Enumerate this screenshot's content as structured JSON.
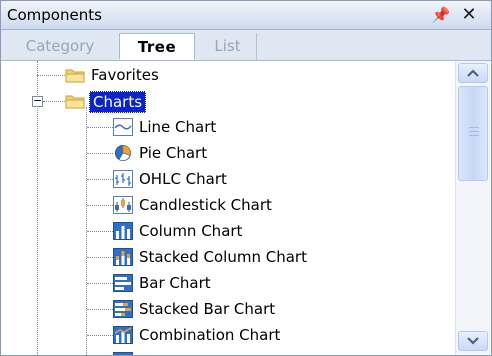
{
  "panel": {
    "title": "Components",
    "pin_icon": "pushpin-icon",
    "close_icon": "close-icon"
  },
  "tabs": [
    {
      "label": "Category",
      "active": false
    },
    {
      "label": "Tree",
      "active": true
    },
    {
      "label": "List",
      "active": false
    }
  ],
  "tree": {
    "items": [
      {
        "label": "Favorites",
        "icon": "folder-icon",
        "level": 0
      },
      {
        "label": "Charts",
        "icon": "folder-icon",
        "level": 0,
        "expanded": true,
        "selected": true
      },
      {
        "label": "Line Chart",
        "icon": "line-chart-icon",
        "level": 1
      },
      {
        "label": "Pie Chart",
        "icon": "pie-chart-icon",
        "level": 1
      },
      {
        "label": "OHLC Chart",
        "icon": "ohlc-chart-icon",
        "level": 1
      },
      {
        "label": "Candlestick Chart",
        "icon": "candlestick-chart-icon",
        "level": 1
      },
      {
        "label": "Column Chart",
        "icon": "column-chart-icon",
        "level": 1
      },
      {
        "label": "Stacked Column Chart",
        "icon": "stacked-column-chart-icon",
        "level": 1
      },
      {
        "label": "Bar Chart",
        "icon": "bar-chart-icon",
        "level": 1
      },
      {
        "label": "Stacked Bar Chart",
        "icon": "stacked-bar-chart-icon",
        "level": 1
      },
      {
        "label": "Combination Chart",
        "icon": "combination-chart-icon",
        "level": 1
      }
    ]
  },
  "colors": {
    "selection": "#0a24c8",
    "folder": "#f5d26b",
    "icon_blue": "#2f6fc9",
    "icon_orange": "#f0a030"
  }
}
